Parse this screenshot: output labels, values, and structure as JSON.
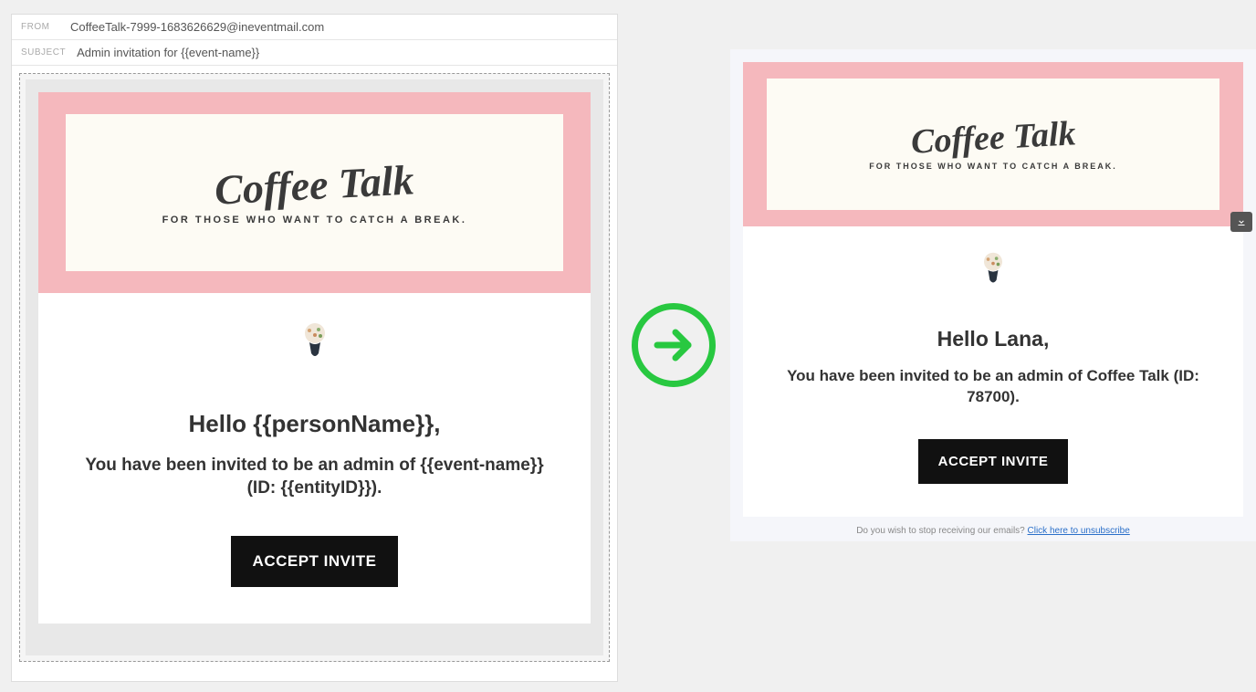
{
  "editor": {
    "from_label": "FROM",
    "from_value": "CoffeeTalk-7999-1683626629@ineventmail.com",
    "subject_label": "SUBJECT",
    "subject_value": "Admin invitation for {{event-name}}",
    "banner": {
      "brand": "Coffee Talk",
      "tagline": "FOR THOSE WHO WANT TO CATCH A BREAK."
    },
    "body": {
      "greeting": "Hello {{personName}},",
      "invite_text": "You have been invited to be an admin of {{event-name}} (ID: {{entityID}}).",
      "accept_label": "ACCEPT INVITE"
    }
  },
  "preview": {
    "banner": {
      "brand": "Coffee Talk",
      "tagline": "FOR THOSE WHO WANT TO CATCH A BREAK."
    },
    "body": {
      "greeting": "Hello Lana,",
      "invite_text": "You have been invited to be an admin of Coffee Talk (ID: 78700).",
      "accept_label": "ACCEPT INVITE"
    },
    "footer": {
      "question": "Do you wish to stop receiving our emails? ",
      "link_text": "Click here to unsubscribe"
    }
  }
}
